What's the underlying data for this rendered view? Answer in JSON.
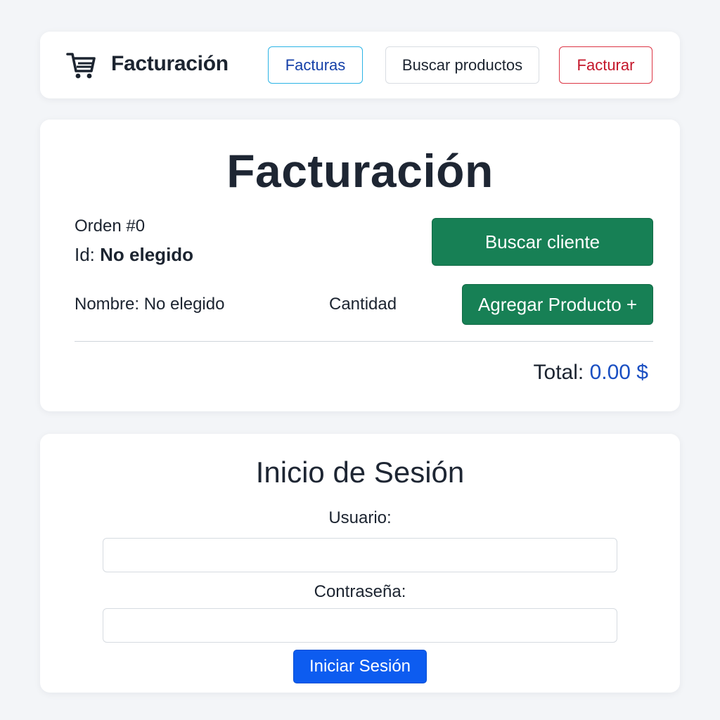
{
  "navbar": {
    "brand": "Facturación",
    "icon": "shopping-cart-icon",
    "links": {
      "facturas": "Facturas",
      "buscar_productos": "Buscar productos",
      "facturar": "Facturar"
    }
  },
  "billing": {
    "title": "Facturación",
    "order_label": "Orden #0",
    "id_label": "Id:",
    "id_value": "No elegido",
    "search_client_button": "Buscar cliente",
    "name_label": "Nombre: No elegido",
    "quantity_label": "Cantidad",
    "add_product_button": "Agregar Producto +",
    "total_label": "Total:",
    "total_value": "0.00 $"
  },
  "login": {
    "title": "Inicio de Sesión",
    "user_label": "Usuario:",
    "user_value": "",
    "password_label": "Contraseña:",
    "password_value": "",
    "submit_button": "Iniciar Sesión"
  },
  "colors": {
    "background": "#f3f5f8",
    "success": "#178055",
    "primary": "#0d5cf0",
    "danger": "#dc3545",
    "info": "#2bb4e6",
    "total_value": "#1a4fc2"
  }
}
